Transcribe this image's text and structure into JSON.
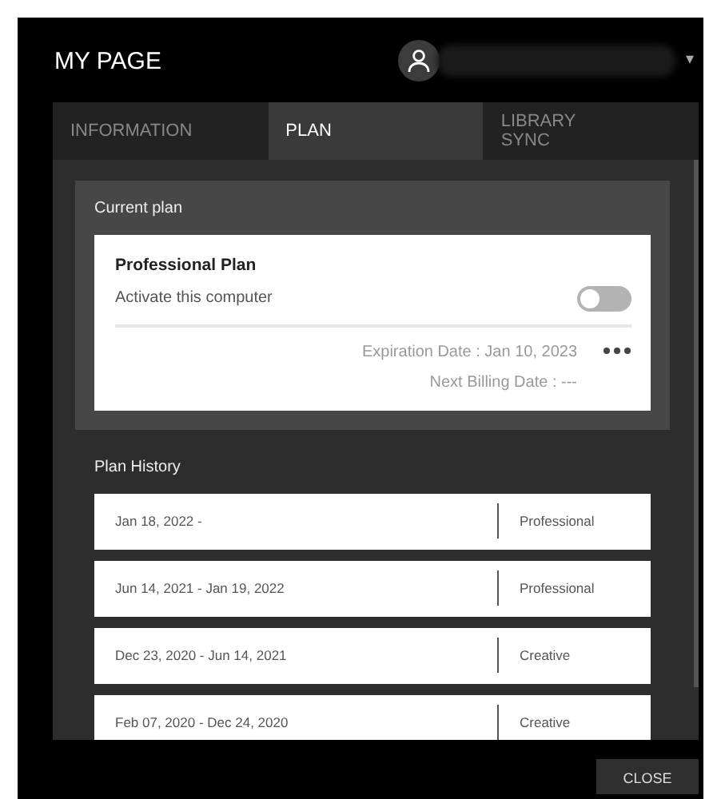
{
  "header": {
    "title": "MY PAGE",
    "account_menu_caret": "▾"
  },
  "tabs": [
    {
      "label": "INFORMATION",
      "selected": false
    },
    {
      "label": "PLAN",
      "selected": true
    },
    {
      "label": "LIBRARY\nSYNC",
      "selected": false
    }
  ],
  "current_plan": {
    "heading": "Current plan",
    "plan_name": "Professional Plan",
    "activate_label": "Activate this computer",
    "activate_on": false,
    "expiration": "Expiration Date : Jan 10, 2023",
    "next_billing": "Next Billing Date : ---"
  },
  "plan_history": {
    "heading": "Plan History",
    "rows": [
      {
        "period": "Jan 18, 2022 -",
        "plan": "Professional"
      },
      {
        "period": "Jun 14, 2021 - Jan 19, 2022",
        "plan": "Professional"
      },
      {
        "period": "Dec 23, 2020 - Jun 14, 2021",
        "plan": "Creative"
      },
      {
        "period": "Feb 07, 2020 - Dec 24, 2020",
        "plan": "Creative"
      }
    ]
  },
  "footer": {
    "close_button": "CLOSE"
  }
}
